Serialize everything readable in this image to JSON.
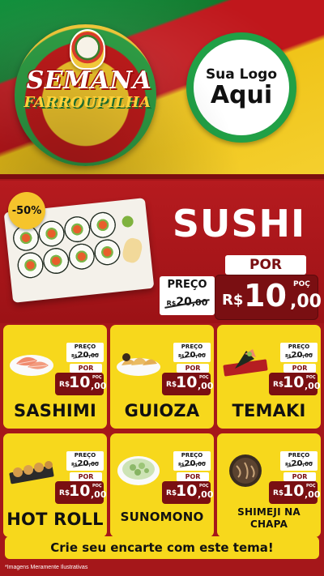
{
  "hero": {
    "title_line1": "SEMANA",
    "title_line2": "FARROUPILHA",
    "logo_line1": "Sua Logo",
    "logo_line2": "Aqui"
  },
  "featured": {
    "discount": "-50%",
    "name": "SUSHI",
    "preco_label": "PREÇO",
    "old_currency": "R$",
    "old_int": "20",
    "old_dec": ",00",
    "por_label": "POR",
    "currency": "R$",
    "price_int": "10",
    "price_poc": "POÇ",
    "price_dec": ",00"
  },
  "products": [
    {
      "name": "SASHIMI",
      "preco_label": "PREÇO",
      "old_currency": "R$",
      "old_int": "20",
      "old_dec": ",00",
      "por_label": "POR",
      "currency": "R$",
      "price_int": "10",
      "price_poc": "POÇ",
      "price_dec": ",00"
    },
    {
      "name": "GUIOZA",
      "preco_label": "PREÇO",
      "old_currency": "R$",
      "old_int": "20",
      "old_dec": ",00",
      "por_label": "POR",
      "currency": "R$",
      "price_int": "10",
      "price_poc": "POÇ",
      "price_dec": ",00"
    },
    {
      "name": "TEMAKI",
      "preco_label": "PREÇO",
      "old_currency": "R$",
      "old_int": "20",
      "old_dec": ",00",
      "por_label": "POR",
      "currency": "R$",
      "price_int": "10",
      "price_poc": "POÇ",
      "price_dec": ",00"
    },
    {
      "name": "HOT ROLL",
      "preco_label": "PREÇO",
      "old_currency": "R$",
      "old_int": "20",
      "old_dec": ",00",
      "por_label": "POR",
      "currency": "R$",
      "price_int": "10",
      "price_poc": "POÇ",
      "price_dec": ",00"
    },
    {
      "name": "SUNOMONO",
      "preco_label": "PREÇO",
      "old_currency": "R$",
      "old_int": "20",
      "old_dec": ",00",
      "por_label": "POR",
      "currency": "R$",
      "price_int": "10",
      "price_poc": "POÇ",
      "price_dec": ",00"
    },
    {
      "name": "SHIMEJI NA CHAPA",
      "preco_label": "PREÇO",
      "old_currency": "R$",
      "old_int": "20",
      "old_dec": ",00",
      "por_label": "POR",
      "currency": "R$",
      "price_int": "10",
      "price_poc": "POÇ",
      "price_dec": ",00"
    }
  ],
  "cta": "Crie seu encarte com este tema!",
  "disclaimer": "*Imagens Meramente Ilustrativas",
  "colors": {
    "red": "#a5171a",
    "dark_red": "#7a0f12",
    "yellow": "#f7d81c",
    "green": "#21a046"
  }
}
